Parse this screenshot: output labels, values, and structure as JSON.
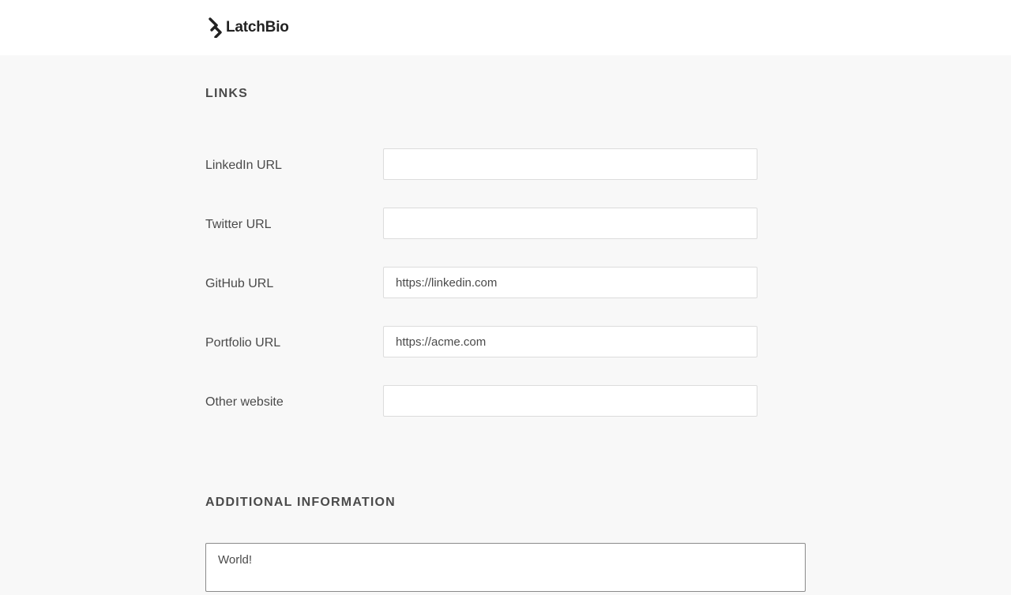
{
  "header": {
    "logo_text": "LatchBio",
    "logo_icon": "latchbio-logo-icon"
  },
  "links_section": {
    "title": "LINKS",
    "fields": [
      {
        "label": "LinkedIn URL",
        "value": "",
        "placeholder": ""
      },
      {
        "label": "Twitter URL",
        "value": "",
        "placeholder": ""
      },
      {
        "label": "GitHub URL",
        "value": "https://linkedin.com",
        "placeholder": ""
      },
      {
        "label": "Portfolio URL",
        "value": "https://acme.com",
        "placeholder": ""
      },
      {
        "label": "Other website",
        "value": "",
        "placeholder": ""
      }
    ]
  },
  "additional_section": {
    "title": "ADDITIONAL INFORMATION",
    "textarea_value": "World!"
  },
  "colors": {
    "page_background": "#f8f8f8",
    "header_background": "#ffffff",
    "text": "#4a4a4a",
    "logo_text": "#222222",
    "field_border": "#dcdcdc",
    "focused_border": "#8a8a8a"
  }
}
